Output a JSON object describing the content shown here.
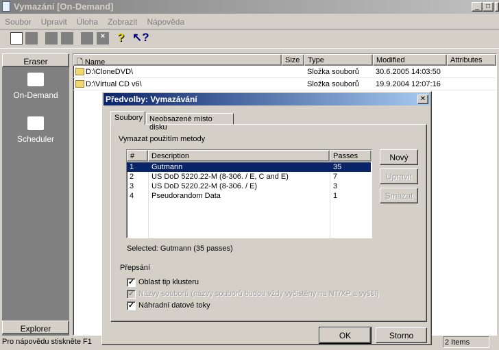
{
  "window": {
    "title": "Vymazání  [On-Demand]",
    "min": "_",
    "max": "□",
    "close": "✕"
  },
  "menu": [
    "Soubor",
    "Upravit",
    "Úloha",
    "Zobrazit",
    "Nápověda"
  ],
  "sidebar": {
    "header": "Eraser",
    "items": [
      {
        "label": "On-Demand"
      },
      {
        "label": "Scheduler"
      }
    ],
    "footer": "Explorer"
  },
  "list": {
    "columns": [
      "Name",
      "Size",
      "Type",
      "Modified",
      "Attributes"
    ],
    "rows": [
      {
        "name": "D:\\CloneDVD\\",
        "size": "",
        "type": "Složka souborů",
        "modified": "30.6.2005 14:03:50",
        "attributes": ""
      },
      {
        "name": "D:\\Virtual CD v6\\",
        "size": "",
        "type": "Složka souborů",
        "modified": "19.9.2004 12:07:16",
        "attributes": ""
      }
    ]
  },
  "status": {
    "hint": "Pro nápovědu stiskněte F1",
    "count": "2 Items"
  },
  "dialog": {
    "title": "Předvolby: Vymazávání",
    "close": "✕",
    "tabs": [
      "Soubory",
      "Neobsazené místo disku"
    ],
    "method_label": "Vymazat použitím metody",
    "table": {
      "columns": [
        "#",
        "Description",
        "Passes"
      ],
      "rows": [
        {
          "n": "1",
          "desc": "Gutmann",
          "passes": "35"
        },
        {
          "n": "2",
          "desc": "US DoD 5220.22-M (8-306. / E, C and E)",
          "passes": "7"
        },
        {
          "n": "3",
          "desc": "US DoD 5220.22-M (8-306. / E)",
          "passes": "3"
        },
        {
          "n": "4",
          "desc": "Pseudorandom Data",
          "passes": "1"
        }
      ]
    },
    "buttons": {
      "new": "Nový",
      "edit": "Upravit",
      "delete": "Smazat",
      "ok": "OK",
      "cancel": "Storno"
    },
    "selected": "Selected: Gutmann (35 passes)",
    "overwrite_label": "Přepsání",
    "checks": [
      {
        "label": "Oblast tip klusteru",
        "checked": true
      },
      {
        "label": "Názvy souborů (názvy souborů budou vždy vyčistěny na NT/XP a vyšší)",
        "checked": true,
        "disabled": true
      },
      {
        "label": "Náhradní datové toky",
        "checked": true
      }
    ]
  },
  "colors": {
    "selection": "#0a246a",
    "dialog_title_start": "#0a246a",
    "dialog_title_end": "#a6caf0"
  }
}
